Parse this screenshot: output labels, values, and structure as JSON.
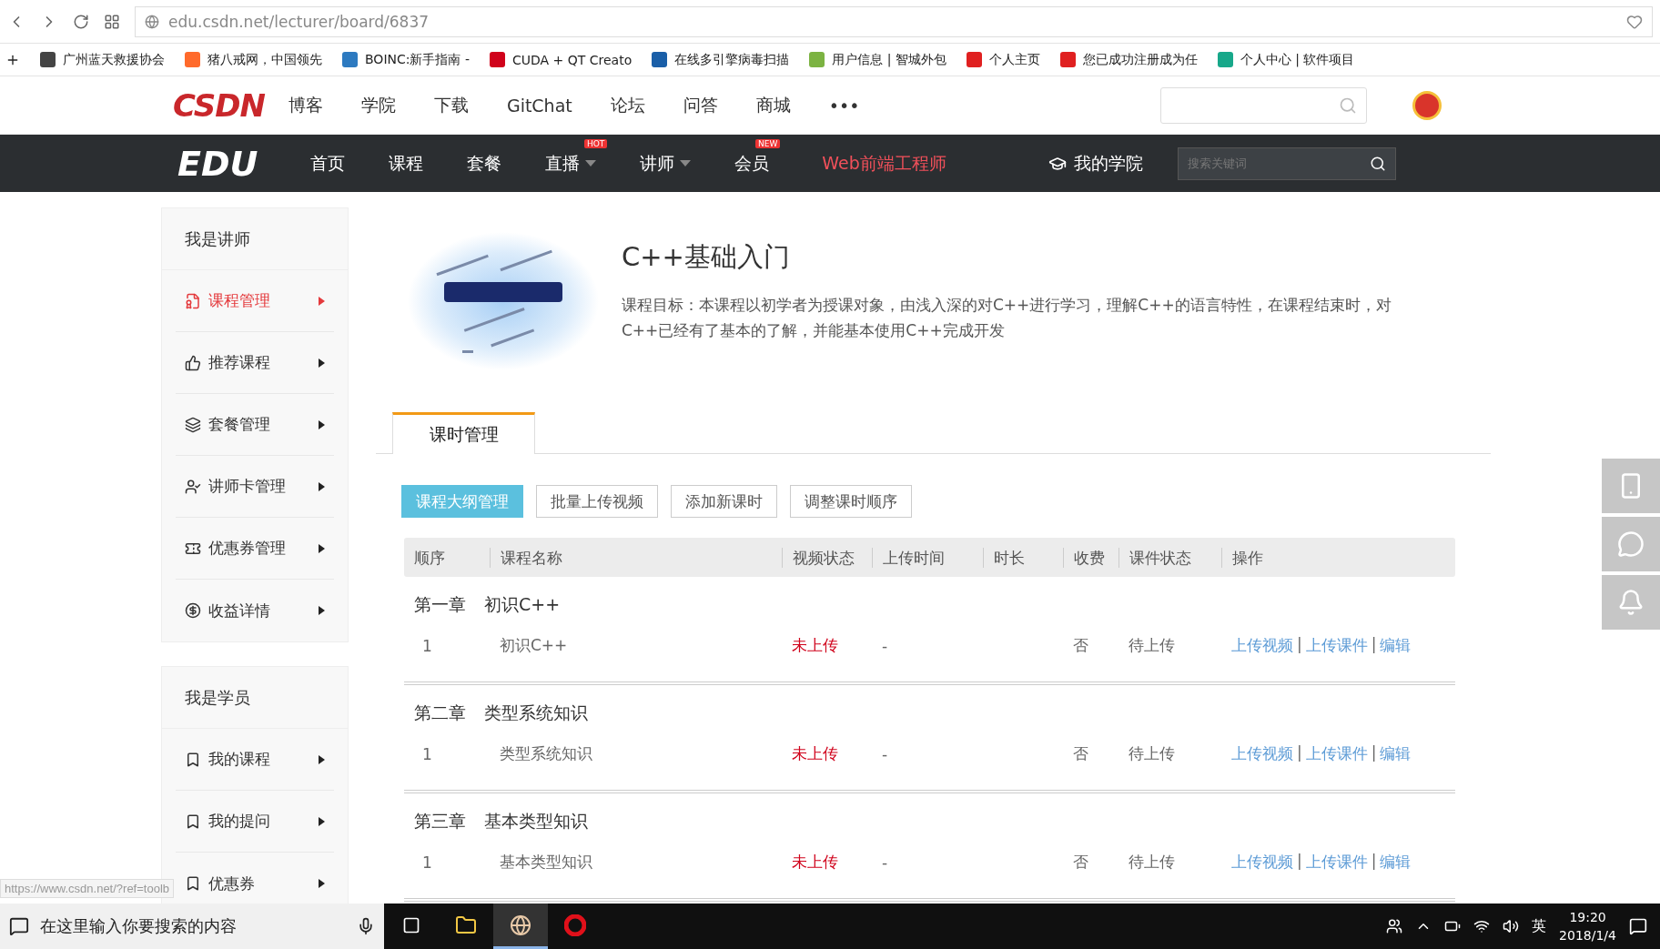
{
  "browser": {
    "url": "edu.csdn.net/lecturer/board/6837",
    "bookmarks": [
      "广州蓝天救援协会",
      "猪八戒网，中国领先",
      "BOINC:新手指南 - ",
      "CUDA + QT Creato",
      "在线多引擎病毒扫描",
      "用户信息 | 智城外包",
      "个人主页",
      "您已成功注册成为任",
      "个人中心 | 软件项目"
    ]
  },
  "topnav": {
    "logo": "CSDN",
    "items": [
      "博客",
      "学院",
      "下载",
      "GitChat",
      "论坛",
      "问答",
      "商城"
    ],
    "more": "•••"
  },
  "edunav": {
    "logo": "EDU",
    "items": [
      {
        "label": "首页"
      },
      {
        "label": "课程"
      },
      {
        "label": "套餐"
      },
      {
        "label": "直播",
        "badge": "HOT",
        "dropdown": true
      },
      {
        "label": "讲师",
        "dropdown": true
      },
      {
        "label": "会员",
        "badge": "NEW"
      }
    ],
    "highlight": "Web前端工程师",
    "my_academy": "我的学院",
    "search_placeholder": "搜索关键词"
  },
  "sidebar": [
    {
      "title": "我是讲师",
      "items": [
        {
          "label": "课程管理",
          "selected": true
        },
        {
          "label": "推荐课程",
          "selected": false
        },
        {
          "label": "套餐管理",
          "selected": false
        },
        {
          "label": "讲师卡管理",
          "selected": false
        },
        {
          "label": "优惠券管理",
          "selected": false
        },
        {
          "label": "收益详情",
          "selected": false
        }
      ]
    },
    {
      "title": "我是学员",
      "items": [
        {
          "label": "我的课程",
          "selected": false
        },
        {
          "label": "我的提问",
          "selected": false
        },
        {
          "label": "优惠券",
          "selected": false
        }
      ]
    }
  ],
  "course": {
    "title": "C++基础入门",
    "description": "课程目标：本课程以初学者为授课对象，由浅入深的对C++进行学习，理解C++的语言特性，在课程结束时，对C++已经有了基本的了解，并能基本使用C++完成开发"
  },
  "tabs": [
    {
      "label": "课时管理",
      "selected": true
    }
  ],
  "actions": [
    {
      "label": "课程大纲管理",
      "selected": true
    },
    {
      "label": "批量上传视频",
      "selected": false
    },
    {
      "label": "添加新课时",
      "selected": false
    },
    {
      "label": "调整课时顺序",
      "selected": false
    }
  ],
  "table": {
    "action_separator": "|",
    "columns": [
      "顺序",
      "课程名称",
      "视频状态",
      "上传时间",
      "时长",
      "收费",
      "课件状态",
      "操作"
    ],
    "chapters": [
      {
        "label": "第一章",
        "name": "初识C++",
        "lessons": [
          {
            "order": "1",
            "name": "初识C++",
            "video_status": "未上传",
            "upload_time": "-",
            "paid": "否",
            "material_status": "待上传",
            "actions": [
              "上传视频",
              "上传课件",
              "编辑"
            ]
          }
        ]
      },
      {
        "label": "第二章",
        "name": "类型系统知识",
        "lessons": [
          {
            "order": "1",
            "name": "类型系统知识",
            "video_status": "未上传",
            "upload_time": "-",
            "paid": "否",
            "material_status": "待上传",
            "actions": [
              "上传视频",
              "上传课件",
              "编辑"
            ]
          }
        ]
      },
      {
        "label": "第三章",
        "name": "基本类型知识",
        "lessons": [
          {
            "order": "1",
            "name": "基本类型知识",
            "video_status": "未上传",
            "upload_time": "-",
            "paid": "否",
            "material_status": "待上传",
            "actions": [
              "上传视频",
              "上传课件",
              "编辑"
            ]
          }
        ]
      }
    ]
  },
  "status_url": "https://www.csdn.net/?ref=toolb",
  "taskbar": {
    "search_placeholder": "在这里输入你要搜索的内容",
    "ime": "英",
    "time": "19:20",
    "date": "2018/1/4"
  }
}
